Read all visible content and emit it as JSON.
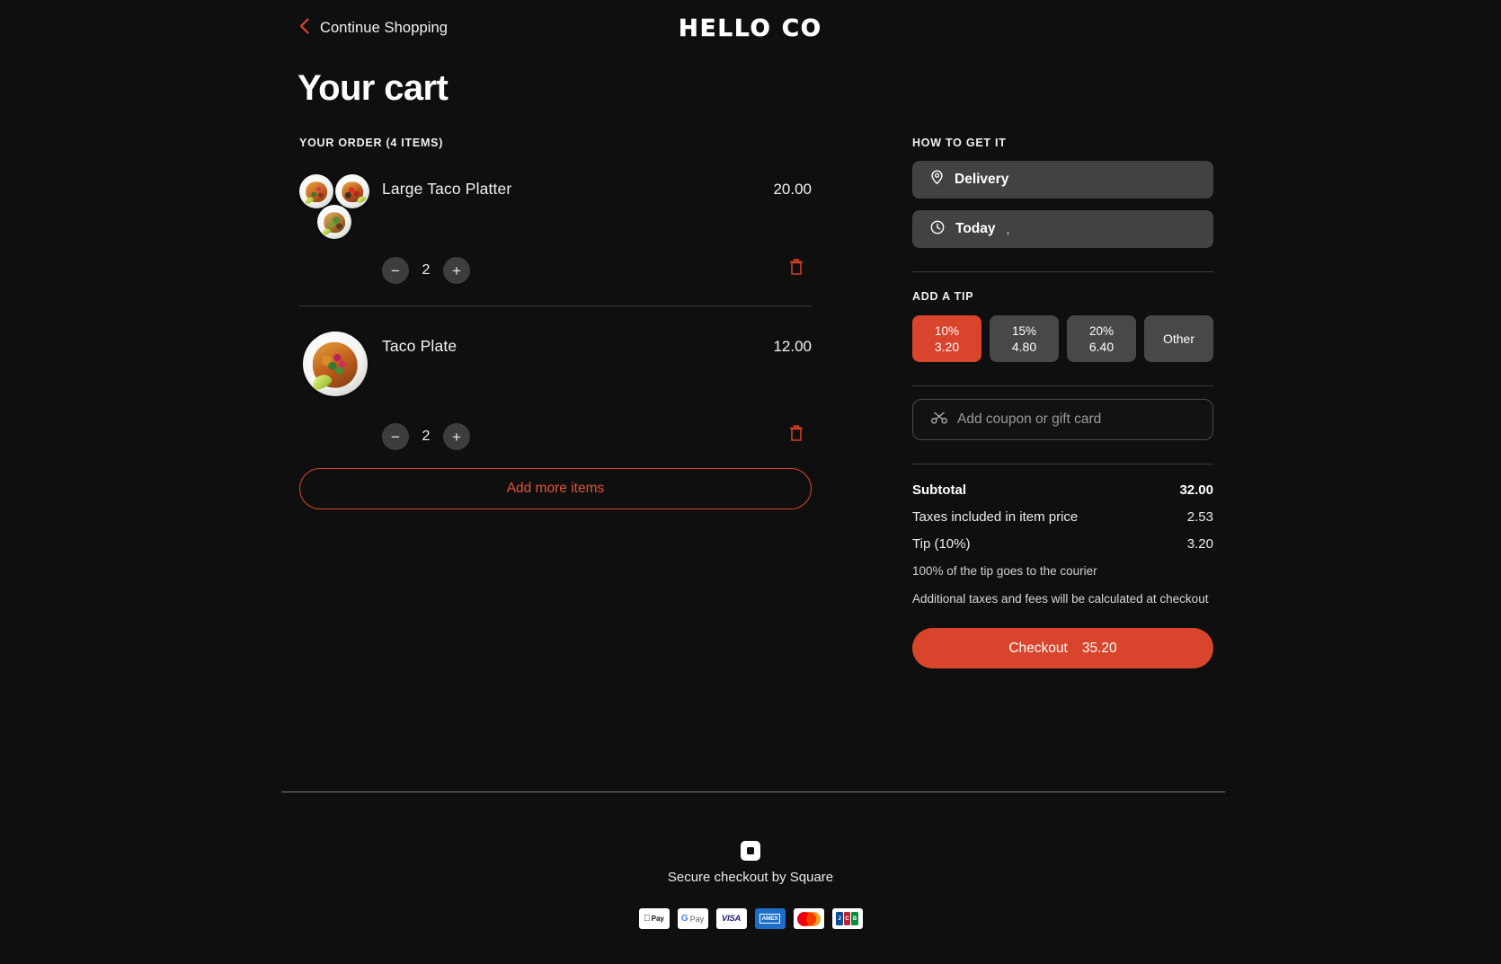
{
  "header": {
    "back_label": "Continue Shopping",
    "back_icon": "chevron-left-icon",
    "brand": "HELLO CO"
  },
  "page_title": "Your cart",
  "order": {
    "section_label": "YOUR ORDER (4 ITEMS)",
    "items": [
      {
        "name": "Large Taco Platter",
        "price": "20.00",
        "quantity": "2",
        "decrement_label": "−",
        "increment_label": "+",
        "thumbnail": "taco-plate-trio-image",
        "remove_icon": "trash-icon"
      },
      {
        "name": "Taco Plate",
        "price": "12.00",
        "quantity": "2",
        "decrement_label": "−",
        "increment_label": "+",
        "thumbnail": "taco-plate-image",
        "remove_icon": "trash-icon"
      }
    ],
    "add_more_label": "Add more items"
  },
  "fulfillment": {
    "section_label": "HOW TO GET IT",
    "method": {
      "icon": "location-pin-icon",
      "label": "Delivery"
    },
    "time": {
      "icon": "clock-icon",
      "label": "Today",
      "detail": ","
    }
  },
  "tip": {
    "section_label": "ADD A TIP",
    "options": [
      {
        "percent": "10%",
        "amount": "3.20",
        "selected": true
      },
      {
        "percent": "15%",
        "amount": "4.80",
        "selected": false
      },
      {
        "percent": "20%",
        "amount": "6.40",
        "selected": false
      },
      {
        "percent": "Other",
        "amount": "",
        "selected": false
      }
    ]
  },
  "coupon": {
    "icon": "coupon-scissors-icon",
    "placeholder": "Add coupon or gift card",
    "value": ""
  },
  "totals": {
    "subtotal_label": "Subtotal",
    "subtotal_value": "32.00",
    "taxes_label": "Taxes included in item price",
    "taxes_value": "2.53",
    "tip_label": "Tip (10%)",
    "tip_value": "3.20",
    "courier_note": "100% of the tip goes to the courier",
    "fees_note": "Additional taxes and fees will be calculated at checkout"
  },
  "checkout": {
    "label": "Checkout",
    "amount": "35.20"
  },
  "footer": {
    "logo_icon": "square-logo-icon",
    "secure_text": "Secure checkout by Square",
    "payment_methods": [
      {
        "name": "apple-pay",
        "label": "Pay"
      },
      {
        "name": "google-pay",
        "label": "Pay"
      },
      {
        "name": "visa",
        "label": "VISA"
      },
      {
        "name": "amex",
        "label": "AMEX"
      },
      {
        "name": "mastercard",
        "label": ""
      },
      {
        "name": "jcb",
        "label": "JCB"
      }
    ]
  },
  "colors": {
    "background": "#0f0f0f",
    "accent": "#d9452c",
    "surface": "#424242",
    "divider": "#3a3a3a"
  }
}
